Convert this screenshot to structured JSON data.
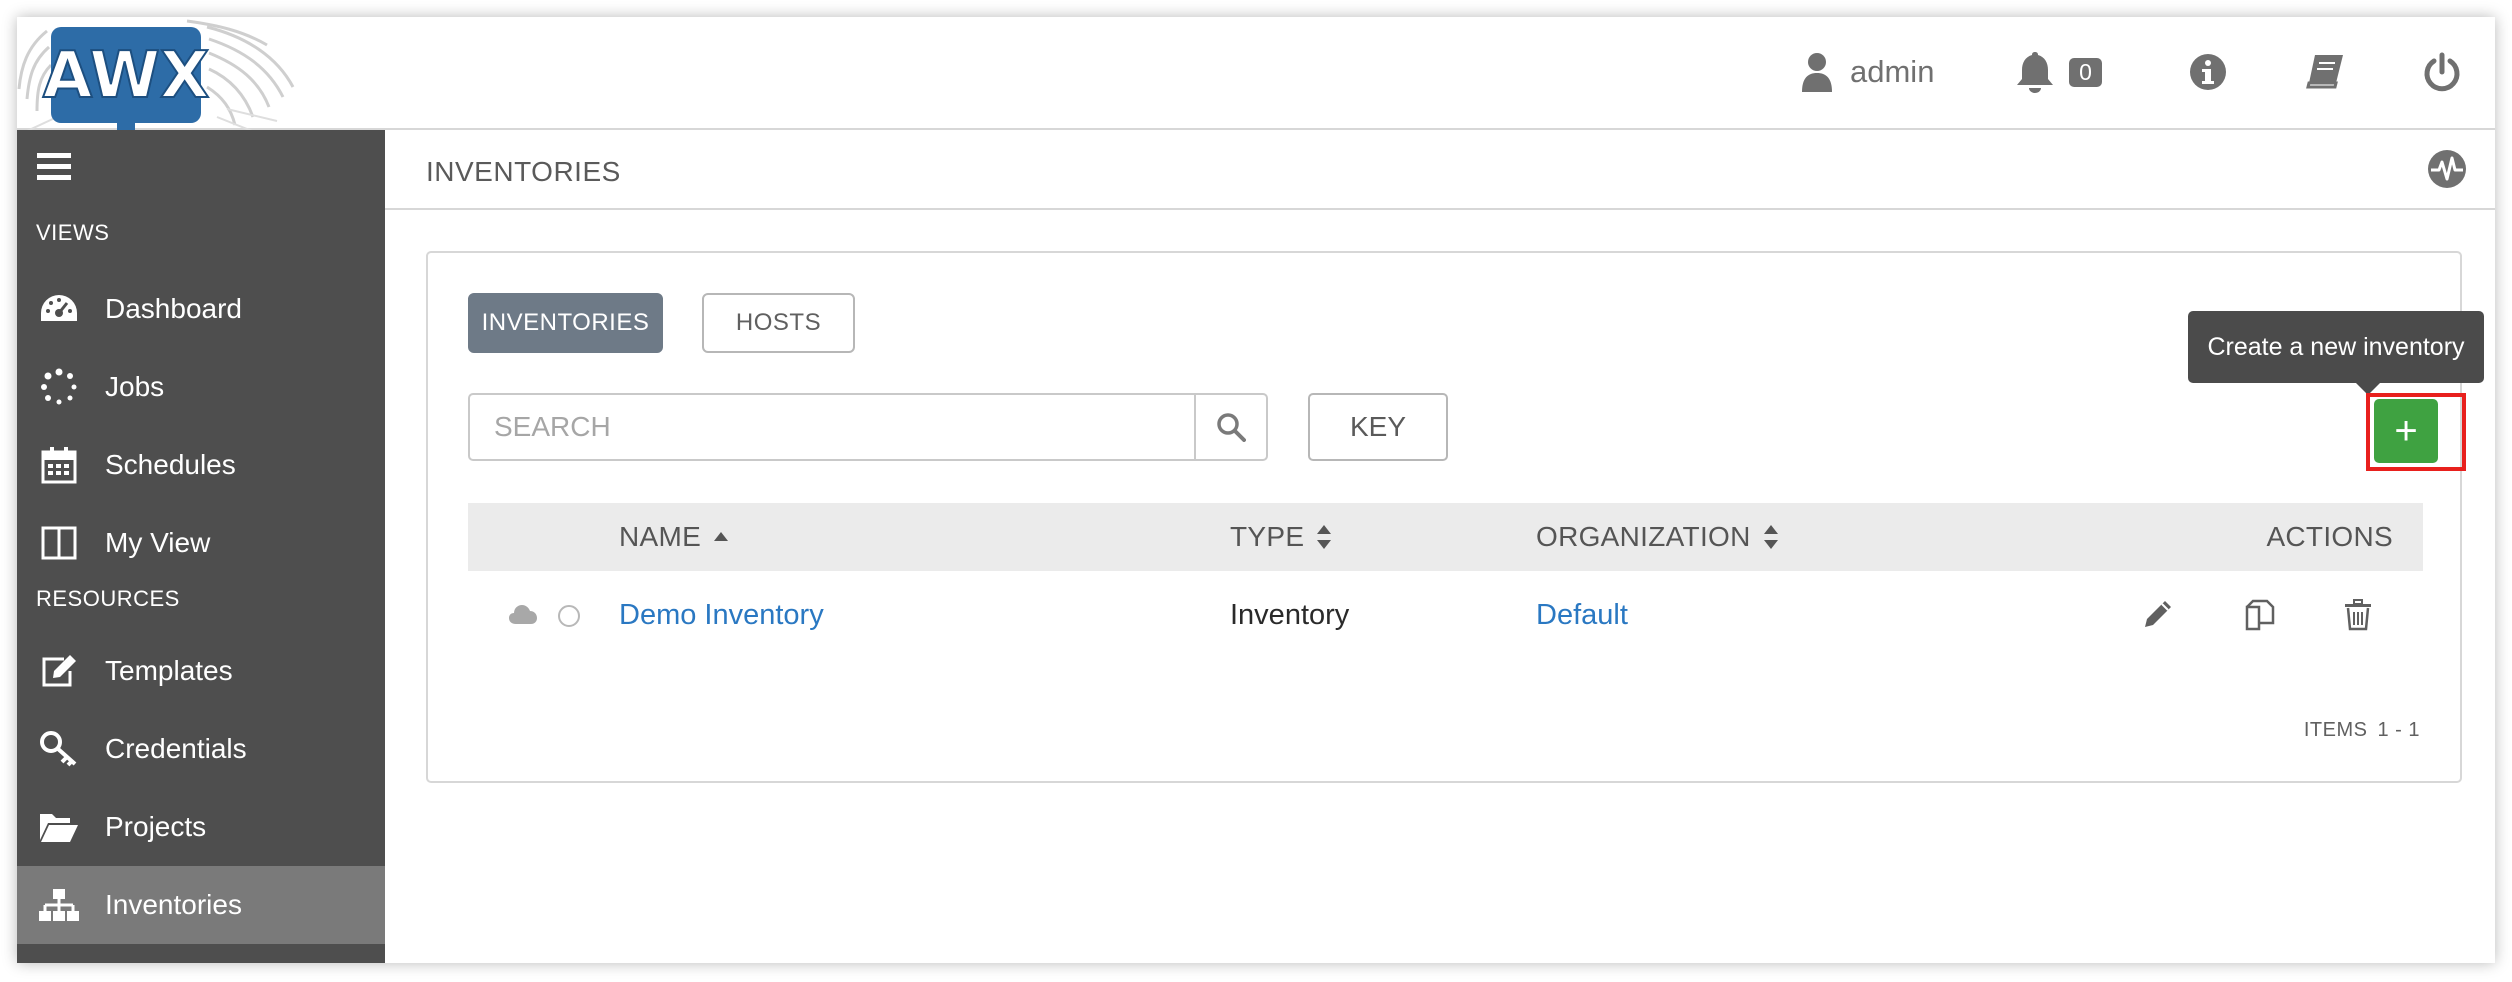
{
  "app": {
    "logo_text": "AWX"
  },
  "topbar": {
    "user_name": "admin",
    "notification_count": "0"
  },
  "sidebar": {
    "views_heading": "VIEWS",
    "resources_heading": "RESOURCES",
    "items": [
      {
        "label": "Dashboard",
        "icon": "dashboard-icon"
      },
      {
        "label": "Jobs",
        "icon": "spinner-icon"
      },
      {
        "label": "Schedules",
        "icon": "calendar-icon"
      },
      {
        "label": "My View",
        "icon": "columns-icon"
      },
      {
        "label": "Templates",
        "icon": "pencil-square-icon"
      },
      {
        "label": "Credentials",
        "icon": "key-icon"
      },
      {
        "label": "Projects",
        "icon": "folder-open-icon"
      },
      {
        "label": "Inventories",
        "icon": "sitemap-icon",
        "active": true
      }
    ]
  },
  "page": {
    "title": "INVENTORIES"
  },
  "tabs": {
    "inventories": "INVENTORIES",
    "hosts": "HOSTS"
  },
  "search": {
    "placeholder": "SEARCH",
    "value": ""
  },
  "key_button": "KEY",
  "add_button": {
    "label": "+",
    "tooltip": "Create a new inventory"
  },
  "table": {
    "headers": {
      "name": "NAME",
      "type": "TYPE",
      "organization": "ORGANIZATION",
      "actions": "ACTIONS"
    },
    "rows": [
      {
        "name": "Demo Inventory",
        "type": "Inventory",
        "organization": "Default"
      }
    ]
  },
  "pagination": {
    "label": "ITEMS",
    "range": "1 - 1"
  },
  "colors": {
    "sidebar_bg": "#4e4e4e",
    "sidebar_active": "#7a7a7a",
    "primary_tab": "#6e7a87",
    "add_button": "#3fa241",
    "link": "#2a78c2",
    "highlight": "#e8201d"
  }
}
